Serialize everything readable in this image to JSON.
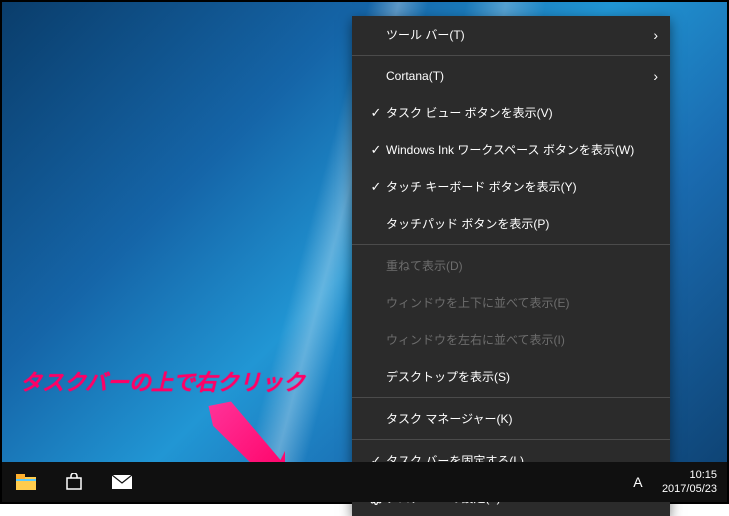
{
  "annotation_text": "タスクバーの上で右クリック",
  "menu": {
    "toolbars": "ツール バー(T)",
    "cortana": "Cortana(T)",
    "show_taskview": "タスク ビュー ボタンを表示(V)",
    "show_ink": "Windows Ink ワークスペース ボタンを表示(W)",
    "show_touchkb": "タッチ キーボード ボタンを表示(Y)",
    "show_touchpad": "タッチパッド ボタンを表示(P)",
    "cascade": "重ねて表示(D)",
    "stack_vert": "ウィンドウを上下に並べて表示(E)",
    "stack_horz": "ウィンドウを左右に並べて表示(I)",
    "show_desktop": "デスクトップを表示(S)",
    "taskmgr": "タスク マネージャー(K)",
    "lock": "タスク バーを固定する(L)",
    "settings": "タスク バーの設定(T)"
  },
  "clock": {
    "time": "10:15",
    "date": "2017/05/23"
  },
  "ime": "A"
}
